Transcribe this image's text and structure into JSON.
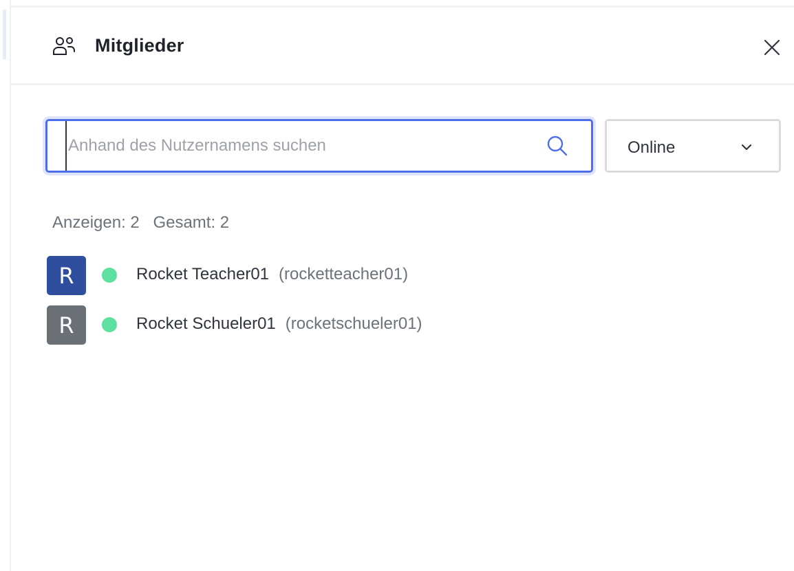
{
  "header": {
    "title": "Mitglieder",
    "icon": "members-icon",
    "close_icon": "close-icon"
  },
  "search": {
    "placeholder": "Anhand des Nutzernamens suchen",
    "value": "",
    "icon": "search-icon"
  },
  "filter": {
    "selected": "Online",
    "icon": "chevron-down-icon"
  },
  "counts": {
    "showing": "Anzeigen: 2",
    "total": "Gesamt: 2"
  },
  "members": [
    {
      "initial": "R",
      "name": "Rocket Teacher01",
      "username": "(rocketteacher01)",
      "avatar_color": "#2f4f9e",
      "status": "online",
      "status_color": "#5ee0a1"
    },
    {
      "initial": "R",
      "name": "Rocket Schueler01",
      "username": "(rocketschueler01)",
      "avatar_color": "#6b6f76",
      "status": "online",
      "status_color": "#5ee0a1"
    }
  ],
  "colors": {
    "accent": "#4d6ee8",
    "text": "#2f343d",
    "muted": "#6c727a"
  }
}
